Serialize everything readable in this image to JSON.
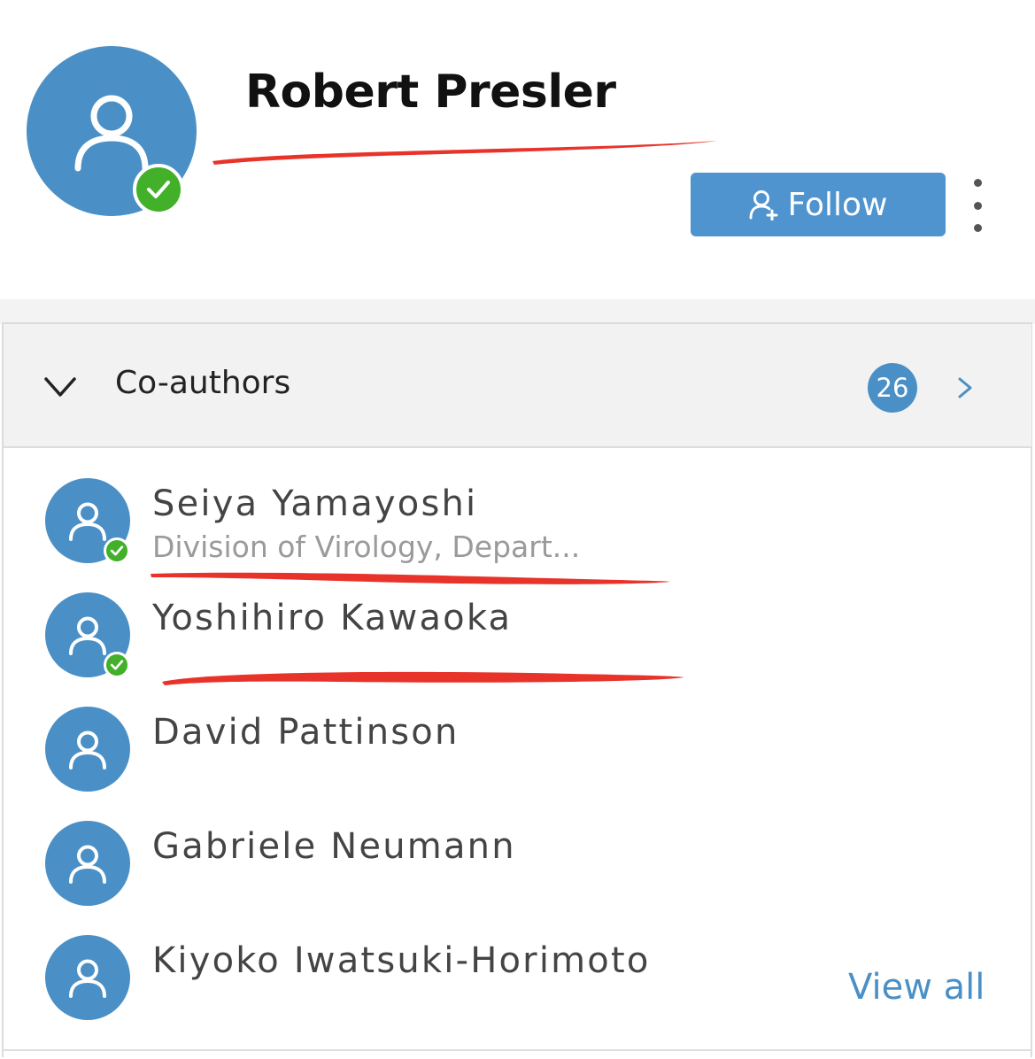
{
  "profile": {
    "name": "Robert Presler",
    "avatar_icon": "user-icon",
    "verified_icon": "check-icon"
  },
  "actions": {
    "follow_label": "Follow",
    "follow_icon": "user-plus-icon",
    "more_icon": "more-vertical-icon"
  },
  "coauthors": {
    "title": "Co-authors",
    "count": "26",
    "collapse_icon": "chevron-down-icon",
    "open_icon": "chevron-right-icon",
    "view_all_label": "View all",
    "items": [
      {
        "name": "Seiya Yamayoshi",
        "affiliation": "Division of Virology, Depart...",
        "verified": true
      },
      {
        "name": "Yoshihiro Kawaoka",
        "affiliation": "",
        "verified": true
      },
      {
        "name": "David Pattinson",
        "affiliation": "",
        "verified": false
      },
      {
        "name": "Gabriele Neumann",
        "affiliation": "",
        "verified": false
      },
      {
        "name": "Kiyoko Iwatsuki-Horimoto",
        "affiliation": "",
        "verified": false
      }
    ]
  },
  "colors": {
    "accent": "#4a90c6",
    "follow_button": "#4f93cf",
    "verified": "#43b02a",
    "annotation": "#e8332a"
  }
}
